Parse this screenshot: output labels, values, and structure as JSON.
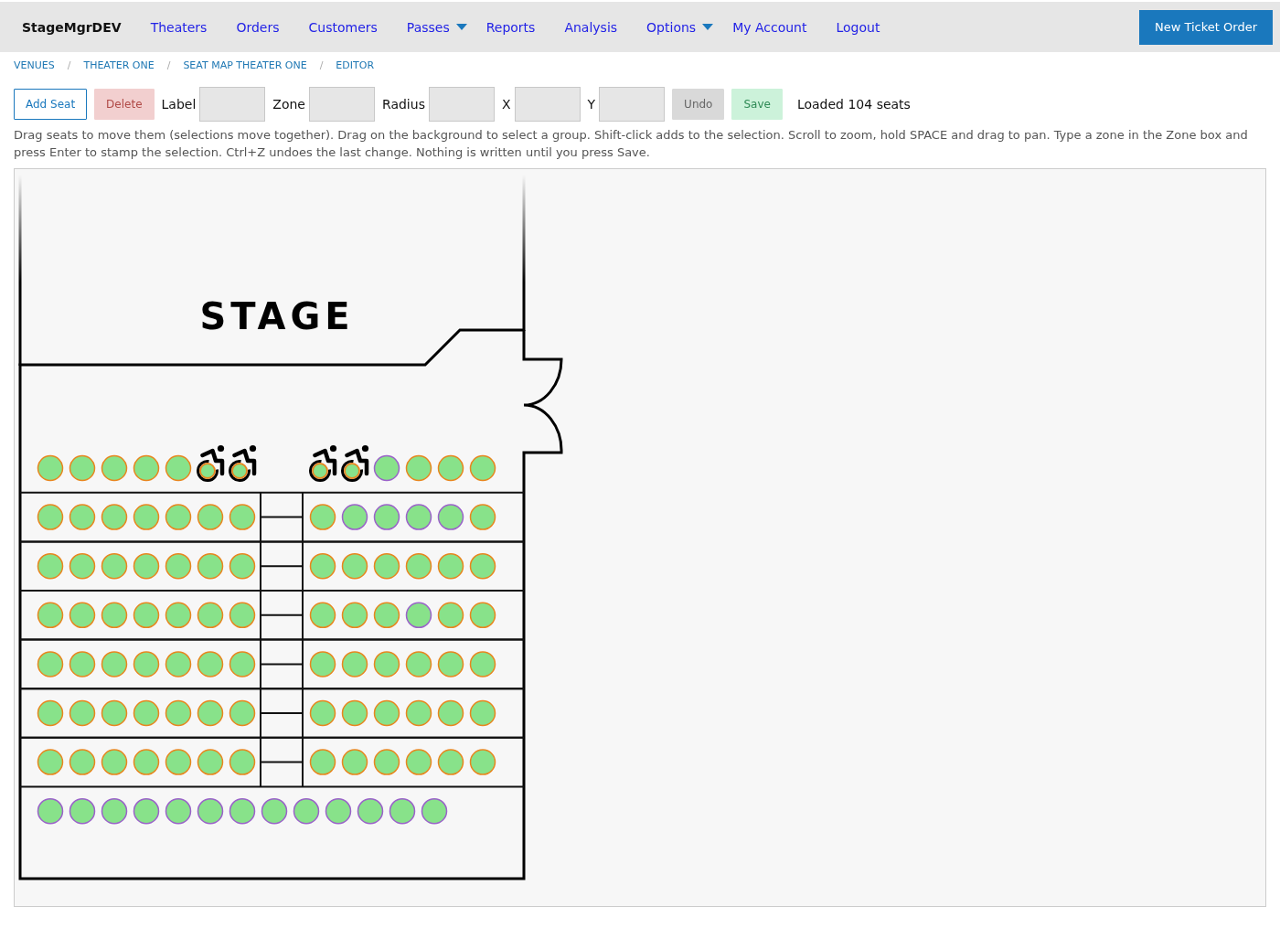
{
  "nav": {
    "brand": "StageMgrDEV",
    "links": [
      {
        "label": "Theaters",
        "dropdown": false
      },
      {
        "label": "Orders",
        "dropdown": false
      },
      {
        "label": "Customers",
        "dropdown": false
      },
      {
        "label": "Passes",
        "dropdown": true
      },
      {
        "label": "Reports",
        "dropdown": false
      },
      {
        "label": "Analysis",
        "dropdown": false
      },
      {
        "label": "Options",
        "dropdown": true
      },
      {
        "label": "My Account",
        "dropdown": false
      },
      {
        "label": "Logout",
        "dropdown": false
      }
    ],
    "action": "New Ticket Order"
  },
  "breadcrumb": [
    {
      "kind": "link",
      "label": "VENUES"
    },
    {
      "kind": "separator",
      "label": "/"
    },
    {
      "kind": "link",
      "label": "THEATER ONE"
    },
    {
      "kind": "separator",
      "label": "/"
    },
    {
      "kind": "link",
      "label": "SEAT MAP THEATER ONE"
    },
    {
      "kind": "separator",
      "label": "/"
    },
    {
      "kind": "link",
      "label": "EDITOR"
    }
  ],
  "toolbar": [
    {
      "kind": "outline",
      "label": "Add Seat",
      "disabled": false
    },
    {
      "kind": "danger",
      "label": "Delete",
      "disabled": true
    },
    {
      "kind": "field",
      "label": "Label"
    },
    {
      "kind": "field",
      "label": "Zone"
    },
    {
      "kind": "field",
      "label": "Radius"
    },
    {
      "kind": "field",
      "label": "X"
    },
    {
      "kind": "field",
      "label": "Y"
    },
    {
      "kind": "neutral",
      "label": "Undo",
      "disabled": true
    },
    {
      "kind": "success",
      "label": "Save",
      "disabled": true
    },
    {
      "kind": "status",
      "label": "Loaded 104 seats"
    }
  ],
  "help": "Drag seats to move them (selections move together). Drag on the background to select a group. Shift-click adds to the selection. Scroll to zoom, hold SPACE and drag to pan. Type a zone in the Zone box and press Enter to stamp the selection. Ctrl+Z undoes the last change. Nothing is written until you press Save.",
  "seat_map": {
    "stage_label": "STAGE",
    "rows": [
      {
        "kind": "open",
        "blocks": [
          {
            "seats": [
              {
                "kind": "standard",
                "color": "#e8861e"
              },
              {
                "kind": "standard",
                "color": "#e8861e"
              },
              {
                "kind": "standard",
                "color": "#e8861e"
              },
              {
                "kind": "standard",
                "color": "#e8861e"
              },
              {
                "kind": "standard",
                "color": "#e8861e"
              },
              {
                "kind": "wheelchair",
                "color": "#e8861e"
              },
              {
                "kind": "wheelchair",
                "color": "#e8861e"
              }
            ]
          },
          {
            "seats": [
              {
                "kind": "wheelchair",
                "color": "#e8861e"
              },
              {
                "kind": "wheelchair",
                "color": "#e8861e"
              },
              {
                "kind": "standard",
                "color": "#9a62c9"
              },
              {
                "kind": "standard",
                "color": "#e8861e"
              },
              {
                "kind": "standard",
                "color": "#e8861e"
              },
              {
                "kind": "standard",
                "color": "#e8861e"
              }
            ]
          }
        ]
      },
      {
        "kind": "boxed",
        "blocks": [
          {
            "seats": [
              {
                "kind": "standard",
                "color": "#e8861e"
              },
              {
                "kind": "standard",
                "color": "#e8861e"
              },
              {
                "kind": "standard",
                "color": "#e8861e"
              },
              {
                "kind": "standard",
                "color": "#e8861e"
              },
              {
                "kind": "standard",
                "color": "#e8861e"
              },
              {
                "kind": "standard",
                "color": "#e8861e"
              },
              {
                "kind": "standard",
                "color": "#e8861e"
              }
            ]
          },
          {
            "seats": [
              {
                "kind": "standard",
                "color": "#e8861e"
              },
              {
                "kind": "standard",
                "color": "#9a62c9"
              },
              {
                "kind": "standard",
                "color": "#9a62c9"
              },
              {
                "kind": "standard",
                "color": "#9a62c9"
              },
              {
                "kind": "standard",
                "color": "#9a62c9"
              },
              {
                "kind": "standard",
                "color": "#e8861e"
              }
            ]
          }
        ]
      },
      {
        "kind": "boxed",
        "blocks": [
          {
            "seats": [
              {
                "kind": "standard",
                "color": "#e8861e"
              },
              {
                "kind": "standard",
                "color": "#e8861e"
              },
              {
                "kind": "standard",
                "color": "#e8861e"
              },
              {
                "kind": "standard",
                "color": "#e8861e"
              },
              {
                "kind": "standard",
                "color": "#e8861e"
              },
              {
                "kind": "standard",
                "color": "#e8861e"
              },
              {
                "kind": "standard",
                "color": "#e8861e"
              }
            ]
          },
          {
            "seats": [
              {
                "kind": "standard",
                "color": "#e8861e"
              },
              {
                "kind": "standard",
                "color": "#e8861e"
              },
              {
                "kind": "standard",
                "color": "#e8861e"
              },
              {
                "kind": "standard",
                "color": "#e8861e"
              },
              {
                "kind": "standard",
                "color": "#e8861e"
              },
              {
                "kind": "standard",
                "color": "#e8861e"
              }
            ]
          }
        ]
      },
      {
        "kind": "boxed",
        "blocks": [
          {
            "seats": [
              {
                "kind": "standard",
                "color": "#e8861e"
              },
              {
                "kind": "standard",
                "color": "#e8861e"
              },
              {
                "kind": "standard",
                "color": "#e8861e"
              },
              {
                "kind": "standard",
                "color": "#e8861e"
              },
              {
                "kind": "standard",
                "color": "#e8861e"
              },
              {
                "kind": "standard",
                "color": "#e8861e"
              },
              {
                "kind": "standard",
                "color": "#e8861e"
              }
            ]
          },
          {
            "seats": [
              {
                "kind": "standard",
                "color": "#e8861e"
              },
              {
                "kind": "standard",
                "color": "#e8861e"
              },
              {
                "kind": "standard",
                "color": "#e8861e"
              },
              {
                "kind": "standard",
                "color": "#9a62c9"
              },
              {
                "kind": "standard",
                "color": "#e8861e"
              },
              {
                "kind": "standard",
                "color": "#e8861e"
              }
            ]
          }
        ]
      },
      {
        "kind": "boxed",
        "blocks": [
          {
            "seats": [
              {
                "kind": "standard",
                "color": "#e8861e"
              },
              {
                "kind": "standard",
                "color": "#e8861e"
              },
              {
                "kind": "standard",
                "color": "#e8861e"
              },
              {
                "kind": "standard",
                "color": "#e8861e"
              },
              {
                "kind": "standard",
                "color": "#e8861e"
              },
              {
                "kind": "standard",
                "color": "#e8861e"
              },
              {
                "kind": "standard",
                "color": "#e8861e"
              }
            ]
          },
          {
            "seats": [
              {
                "kind": "standard",
                "color": "#e8861e"
              },
              {
                "kind": "standard",
                "color": "#e8861e"
              },
              {
                "kind": "standard",
                "color": "#e8861e"
              },
              {
                "kind": "standard",
                "color": "#e8861e"
              },
              {
                "kind": "standard",
                "color": "#e8861e"
              },
              {
                "kind": "standard",
                "color": "#e8861e"
              }
            ]
          }
        ]
      },
      {
        "kind": "boxed",
        "blocks": [
          {
            "seats": [
              {
                "kind": "standard",
                "color": "#e8861e"
              },
              {
                "kind": "standard",
                "color": "#e8861e"
              },
              {
                "kind": "standard",
                "color": "#e8861e"
              },
              {
                "kind": "standard",
                "color": "#e8861e"
              },
              {
                "kind": "standard",
                "color": "#e8861e"
              },
              {
                "kind": "standard",
                "color": "#e8861e"
              },
              {
                "kind": "standard",
                "color": "#e8861e"
              }
            ]
          },
          {
            "seats": [
              {
                "kind": "standard",
                "color": "#e8861e"
              },
              {
                "kind": "standard",
                "color": "#e8861e"
              },
              {
                "kind": "standard",
                "color": "#e8861e"
              },
              {
                "kind": "standard",
                "color": "#e8861e"
              },
              {
                "kind": "standard",
                "color": "#e8861e"
              },
              {
                "kind": "standard",
                "color": "#e8861e"
              }
            ]
          }
        ]
      },
      {
        "kind": "boxed",
        "blocks": [
          {
            "seats": [
              {
                "kind": "standard",
                "color": "#e8861e"
              },
              {
                "kind": "standard",
                "color": "#e8861e"
              },
              {
                "kind": "standard",
                "color": "#e8861e"
              },
              {
                "kind": "standard",
                "color": "#e8861e"
              },
              {
                "kind": "standard",
                "color": "#e8861e"
              },
              {
                "kind": "standard",
                "color": "#e8861e"
              },
              {
                "kind": "standard",
                "color": "#e8861e"
              }
            ]
          },
          {
            "seats": [
              {
                "kind": "standard",
                "color": "#e8861e"
              },
              {
                "kind": "standard",
                "color": "#e8861e"
              },
              {
                "kind": "standard",
                "color": "#e8861e"
              },
              {
                "kind": "standard",
                "color": "#e8861e"
              },
              {
                "kind": "standard",
                "color": "#e8861e"
              },
              {
                "kind": "standard",
                "color": "#e8861e"
              }
            ]
          }
        ]
      },
      {
        "kind": "open",
        "blocks": [
          {
            "seats": [
              {
                "kind": "standard",
                "color": "#9a62c9"
              },
              {
                "kind": "standard",
                "color": "#9a62c9"
              },
              {
                "kind": "standard",
                "color": "#9a62c9"
              },
              {
                "kind": "standard",
                "color": "#9a62c9"
              },
              {
                "kind": "standard",
                "color": "#9a62c9"
              },
              {
                "kind": "standard",
                "color": "#9a62c9"
              },
              {
                "kind": "standard",
                "color": "#9a62c9"
              },
              {
                "kind": "standard",
                "color": "#9a62c9"
              },
              {
                "kind": "standard",
                "color": "#9a62c9"
              },
              {
                "kind": "standard",
                "color": "#9a62c9"
              },
              {
                "kind": "standard",
                "color": "#9a62c9"
              },
              {
                "kind": "standard",
                "color": "#9a62c9"
              },
              {
                "kind": "standard",
                "color": "#9a62c9"
              }
            ]
          }
        ]
      }
    ]
  }
}
